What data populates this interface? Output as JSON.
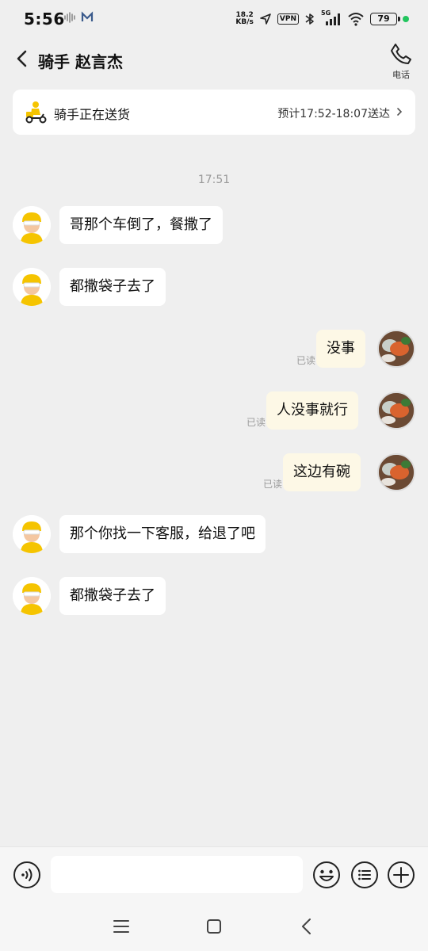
{
  "status_bar": {
    "time": "5:56",
    "net_speed_value": "18.2",
    "net_speed_unit": "KB/s",
    "vpn": "VPN",
    "network": "5G",
    "battery": "79"
  },
  "header": {
    "title": "骑手 赵言杰",
    "call_label": "电话"
  },
  "delivery": {
    "status": "骑手正在送货",
    "eta": "预计17:52-18:07送达"
  },
  "chat": {
    "timestamp": "17:51",
    "read_label": "已读",
    "messages": [
      {
        "from": "rider",
        "text": "哥那个车倒了，餐撒了"
      },
      {
        "from": "rider",
        "text": "都撒袋子去了"
      },
      {
        "from": "me",
        "text": "没事",
        "read": "已读"
      },
      {
        "from": "me",
        "text": "人没事就行",
        "read": "已读"
      },
      {
        "from": "me",
        "text": "这边有碗",
        "read": "已读"
      },
      {
        "from": "rider",
        "text": "那个你找一下客服，给退了吧"
      },
      {
        "from": "rider",
        "text": "都撒袋子去了"
      }
    ]
  },
  "input_bar": {
    "value": "",
    "placeholder": ""
  },
  "icons": {
    "back": "back-chevron-icon",
    "call": "phone-icon",
    "scooter": "scooter-rider-icon",
    "voice": "voice-icon",
    "emoji": "emoji-icon",
    "quick_reply": "list-icon",
    "more": "plus-icon"
  },
  "colors": {
    "background": "#efefef",
    "incoming_bubble": "#ffffff",
    "outgoing_bubble": "#fdf8e6",
    "rider_helmet": "#f5c400",
    "status_dot": "#22c55e"
  }
}
